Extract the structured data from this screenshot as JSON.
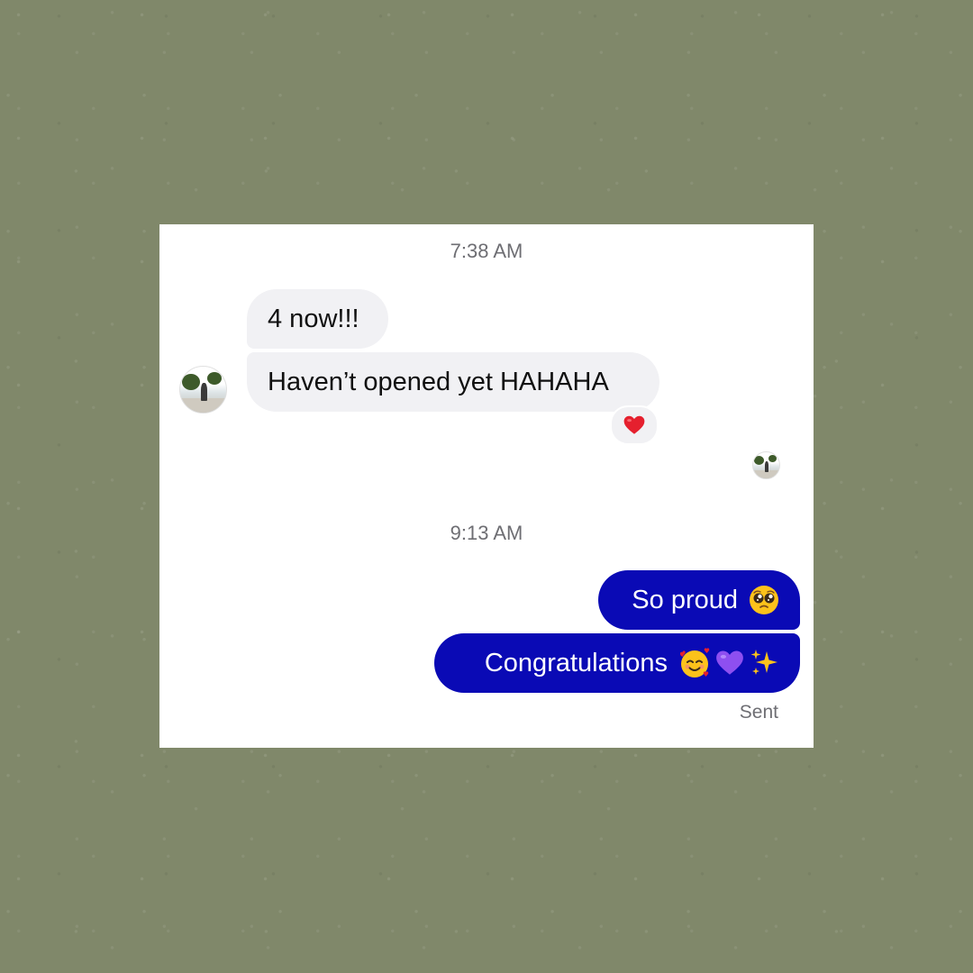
{
  "conversation": {
    "timestamps": [
      "7:38 AM",
      "9:13 AM"
    ],
    "incoming": [
      {
        "text": "4 now!!!"
      },
      {
        "text": "Haven’t opened yet HAHAHA",
        "reaction": "red-heart-icon"
      }
    ],
    "outgoing": [
      {
        "text": "So proud",
        "emoji": [
          "pleading-face-icon"
        ]
      },
      {
        "text": "Congratulations",
        "emoji": [
          "smiling-face-with-hearts-icon",
          "purple-heart-icon",
          "sparkles-icon"
        ]
      }
    ],
    "status": "Sent"
  },
  "colors": {
    "background": "#80886a",
    "card": "#ffffff",
    "incoming_bubble": "#f1f1f4",
    "outgoing_bubble": "#0a0ab5",
    "meta_text": "#6e6e73",
    "heart": "#e5202e",
    "purple_heart": "#8e4ff0"
  }
}
